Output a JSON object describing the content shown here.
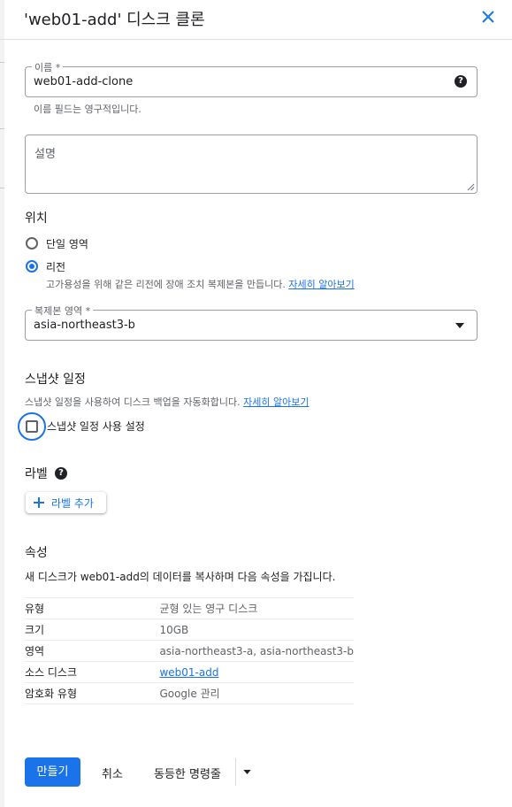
{
  "dialog": {
    "title": "'web01-add' 디스크 클론"
  },
  "name_field": {
    "label": "이름 *",
    "value": "web01-add-clone",
    "hint": "이름 필드는 영구적입니다."
  },
  "description_field": {
    "placeholder": "설명"
  },
  "location": {
    "heading": "위치",
    "options": [
      {
        "label": "단일 영역",
        "selected": false
      },
      {
        "label": "리전",
        "selected": true
      }
    ],
    "region_hint": "고가용성을 위해 같은 리전에 장애 조치 복제본을 만듭니다.",
    "learn_more": "자세히 알아보기",
    "replica_zone": {
      "label": "복제본 영역 *",
      "value": "asia-northeast3-b"
    }
  },
  "snapshot": {
    "heading": "스냅샷 일정",
    "hint": "스냅샷 일정을 사용하여 디스크 백업을 자동화합니다.",
    "learn_more": "자세히 알아보기",
    "checkbox_label": "스냅샷 일정 사용 설정",
    "checked": false
  },
  "labels": {
    "heading": "라벨",
    "add_button": "라벨 추가"
  },
  "properties": {
    "heading": "속성",
    "description": "새 디스크가 web01-add의 데이터를 복사하며 다음 속성을 가집니다.",
    "rows": [
      {
        "key": "유형",
        "value": "균형 있는 영구 디스크"
      },
      {
        "key": "크기",
        "value": "10GB"
      },
      {
        "key": "영역",
        "value": "asia-northeast3-a, asia-northeast3-b"
      },
      {
        "key": "소스 디스크",
        "value": "web01-add"
      },
      {
        "key": "암호화 유형",
        "value": "Google 관리"
      }
    ]
  },
  "footer": {
    "create": "만들기",
    "cancel": "취소",
    "equivalent_command": "동등한 명령줄"
  },
  "colors": {
    "accent": "#1a73e8",
    "text": "#202124",
    "muted": "#5f6368"
  }
}
